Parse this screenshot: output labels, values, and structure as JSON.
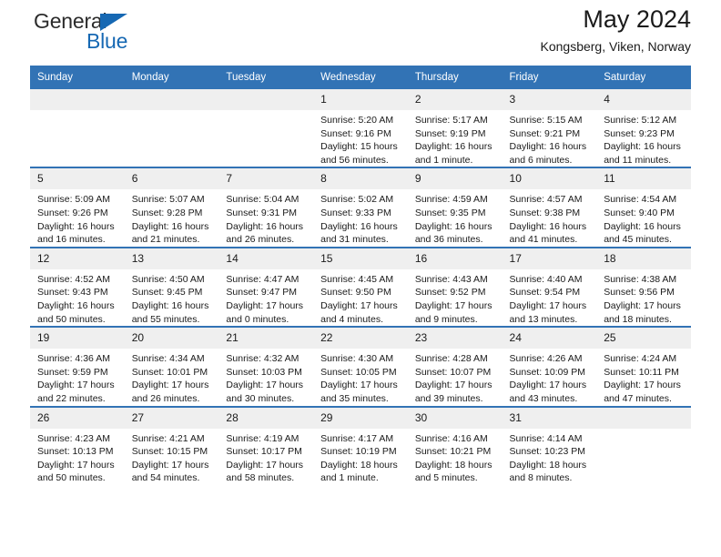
{
  "brand": {
    "name_top": "General",
    "name_bottom": "Blue",
    "triangle_color": "#1668b3"
  },
  "header": {
    "month_title": "May 2024",
    "location": "Kongsberg, Viken, Norway"
  },
  "theme": {
    "header_bar": "#3273b5",
    "daynum_band": "#efefef",
    "accent": "#1668b3"
  },
  "weekday_headers": [
    "Sunday",
    "Monday",
    "Tuesday",
    "Wednesday",
    "Thursday",
    "Friday",
    "Saturday"
  ],
  "labels": {
    "sunrise_prefix": "Sunrise:",
    "sunset_prefix": "Sunset:",
    "daylight_prefix": "Daylight:"
  },
  "weeks": [
    [
      {
        "empty": true
      },
      {
        "empty": true
      },
      {
        "empty": true
      },
      {
        "day": "1",
        "sunrise": "Sunrise: 5:20 AM",
        "sunset": "Sunset: 9:16 PM",
        "daylight_l1": "Daylight: 15 hours",
        "daylight_l2": "and 56 minutes."
      },
      {
        "day": "2",
        "sunrise": "Sunrise: 5:17 AM",
        "sunset": "Sunset: 9:19 PM",
        "daylight_l1": "Daylight: 16 hours",
        "daylight_l2": "and 1 minute."
      },
      {
        "day": "3",
        "sunrise": "Sunrise: 5:15 AM",
        "sunset": "Sunset: 9:21 PM",
        "daylight_l1": "Daylight: 16 hours",
        "daylight_l2": "and 6 minutes."
      },
      {
        "day": "4",
        "sunrise": "Sunrise: 5:12 AM",
        "sunset": "Sunset: 9:23 PM",
        "daylight_l1": "Daylight: 16 hours",
        "daylight_l2": "and 11 minutes."
      }
    ],
    [
      {
        "day": "5",
        "sunrise": "Sunrise: 5:09 AM",
        "sunset": "Sunset: 9:26 PM",
        "daylight_l1": "Daylight: 16 hours",
        "daylight_l2": "and 16 minutes."
      },
      {
        "day": "6",
        "sunrise": "Sunrise: 5:07 AM",
        "sunset": "Sunset: 9:28 PM",
        "daylight_l1": "Daylight: 16 hours",
        "daylight_l2": "and 21 minutes."
      },
      {
        "day": "7",
        "sunrise": "Sunrise: 5:04 AM",
        "sunset": "Sunset: 9:31 PM",
        "daylight_l1": "Daylight: 16 hours",
        "daylight_l2": "and 26 minutes."
      },
      {
        "day": "8",
        "sunrise": "Sunrise: 5:02 AM",
        "sunset": "Sunset: 9:33 PM",
        "daylight_l1": "Daylight: 16 hours",
        "daylight_l2": "and 31 minutes."
      },
      {
        "day": "9",
        "sunrise": "Sunrise: 4:59 AM",
        "sunset": "Sunset: 9:35 PM",
        "daylight_l1": "Daylight: 16 hours",
        "daylight_l2": "and 36 minutes."
      },
      {
        "day": "10",
        "sunrise": "Sunrise: 4:57 AM",
        "sunset": "Sunset: 9:38 PM",
        "daylight_l1": "Daylight: 16 hours",
        "daylight_l2": "and 41 minutes."
      },
      {
        "day": "11",
        "sunrise": "Sunrise: 4:54 AM",
        "sunset": "Sunset: 9:40 PM",
        "daylight_l1": "Daylight: 16 hours",
        "daylight_l2": "and 45 minutes."
      }
    ],
    [
      {
        "day": "12",
        "sunrise": "Sunrise: 4:52 AM",
        "sunset": "Sunset: 9:43 PM",
        "daylight_l1": "Daylight: 16 hours",
        "daylight_l2": "and 50 minutes."
      },
      {
        "day": "13",
        "sunrise": "Sunrise: 4:50 AM",
        "sunset": "Sunset: 9:45 PM",
        "daylight_l1": "Daylight: 16 hours",
        "daylight_l2": "and 55 minutes."
      },
      {
        "day": "14",
        "sunrise": "Sunrise: 4:47 AM",
        "sunset": "Sunset: 9:47 PM",
        "daylight_l1": "Daylight: 17 hours",
        "daylight_l2": "and 0 minutes."
      },
      {
        "day": "15",
        "sunrise": "Sunrise: 4:45 AM",
        "sunset": "Sunset: 9:50 PM",
        "daylight_l1": "Daylight: 17 hours",
        "daylight_l2": "and 4 minutes."
      },
      {
        "day": "16",
        "sunrise": "Sunrise: 4:43 AM",
        "sunset": "Sunset: 9:52 PM",
        "daylight_l1": "Daylight: 17 hours",
        "daylight_l2": "and 9 minutes."
      },
      {
        "day": "17",
        "sunrise": "Sunrise: 4:40 AM",
        "sunset": "Sunset: 9:54 PM",
        "daylight_l1": "Daylight: 17 hours",
        "daylight_l2": "and 13 minutes."
      },
      {
        "day": "18",
        "sunrise": "Sunrise: 4:38 AM",
        "sunset": "Sunset: 9:56 PM",
        "daylight_l1": "Daylight: 17 hours",
        "daylight_l2": "and 18 minutes."
      }
    ],
    [
      {
        "day": "19",
        "sunrise": "Sunrise: 4:36 AM",
        "sunset": "Sunset: 9:59 PM",
        "daylight_l1": "Daylight: 17 hours",
        "daylight_l2": "and 22 minutes."
      },
      {
        "day": "20",
        "sunrise": "Sunrise: 4:34 AM",
        "sunset": "Sunset: 10:01 PM",
        "daylight_l1": "Daylight: 17 hours",
        "daylight_l2": "and 26 minutes."
      },
      {
        "day": "21",
        "sunrise": "Sunrise: 4:32 AM",
        "sunset": "Sunset: 10:03 PM",
        "daylight_l1": "Daylight: 17 hours",
        "daylight_l2": "and 30 minutes."
      },
      {
        "day": "22",
        "sunrise": "Sunrise: 4:30 AM",
        "sunset": "Sunset: 10:05 PM",
        "daylight_l1": "Daylight: 17 hours",
        "daylight_l2": "and 35 minutes."
      },
      {
        "day": "23",
        "sunrise": "Sunrise: 4:28 AM",
        "sunset": "Sunset: 10:07 PM",
        "daylight_l1": "Daylight: 17 hours",
        "daylight_l2": "and 39 minutes."
      },
      {
        "day": "24",
        "sunrise": "Sunrise: 4:26 AM",
        "sunset": "Sunset: 10:09 PM",
        "daylight_l1": "Daylight: 17 hours",
        "daylight_l2": "and 43 minutes."
      },
      {
        "day": "25",
        "sunrise": "Sunrise: 4:24 AM",
        "sunset": "Sunset: 10:11 PM",
        "daylight_l1": "Daylight: 17 hours",
        "daylight_l2": "and 47 minutes."
      }
    ],
    [
      {
        "day": "26",
        "sunrise": "Sunrise: 4:23 AM",
        "sunset": "Sunset: 10:13 PM",
        "daylight_l1": "Daylight: 17 hours",
        "daylight_l2": "and 50 minutes."
      },
      {
        "day": "27",
        "sunrise": "Sunrise: 4:21 AM",
        "sunset": "Sunset: 10:15 PM",
        "daylight_l1": "Daylight: 17 hours",
        "daylight_l2": "and 54 minutes."
      },
      {
        "day": "28",
        "sunrise": "Sunrise: 4:19 AM",
        "sunset": "Sunset: 10:17 PM",
        "daylight_l1": "Daylight: 17 hours",
        "daylight_l2": "and 58 minutes."
      },
      {
        "day": "29",
        "sunrise": "Sunrise: 4:17 AM",
        "sunset": "Sunset: 10:19 PM",
        "daylight_l1": "Daylight: 18 hours",
        "daylight_l2": "and 1 minute."
      },
      {
        "day": "30",
        "sunrise": "Sunrise: 4:16 AM",
        "sunset": "Sunset: 10:21 PM",
        "daylight_l1": "Daylight: 18 hours",
        "daylight_l2": "and 5 minutes."
      },
      {
        "day": "31",
        "sunrise": "Sunrise: 4:14 AM",
        "sunset": "Sunset: 10:23 PM",
        "daylight_l1": "Daylight: 18 hours",
        "daylight_l2": "and 8 minutes."
      },
      {
        "empty": true
      }
    ]
  ]
}
